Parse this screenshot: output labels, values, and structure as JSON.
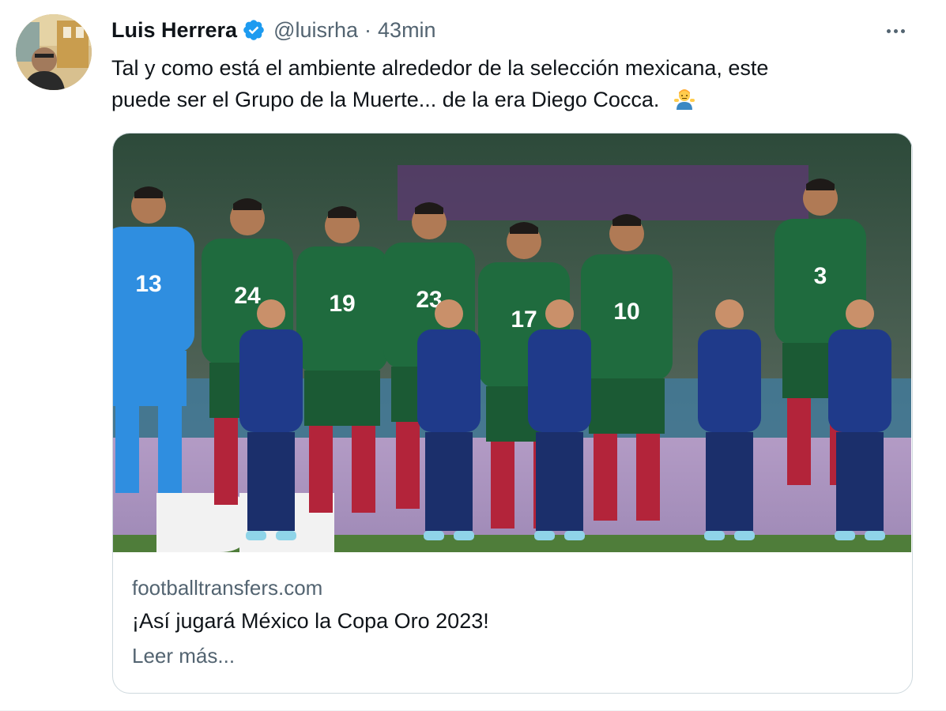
{
  "author": {
    "name": "Luis Herrera",
    "handle": "@luisrha",
    "separator": "·",
    "time": "43min"
  },
  "tweet": {
    "line1": "Tal y como está el ambiente alrededor de la selección mexicana, este",
    "line2": "puede ser el Grupo de la Muerte... de la era Diego Cocca.",
    "emoji": "man-shrugging-emoji"
  },
  "card": {
    "image": "mexico-national-team-lineup-photo",
    "jersey_numbers": [
      "13",
      "24",
      "19",
      "23",
      "17",
      "10",
      "3"
    ],
    "domain": "footballtransfers.com",
    "title": "¡Así jugará México la Copa Oro 2023!",
    "read_more": "Leer más..."
  },
  "icons": {
    "verified": "verified-badge-icon",
    "more": "more-options-icon"
  },
  "colors": {
    "verified_blue": "#1d9bf0",
    "secondary_text": "#536471",
    "jersey_green": "#1f6b3e",
    "keeper_blue": "#2f8ee0",
    "kids_navy": "#1f3a8a"
  }
}
